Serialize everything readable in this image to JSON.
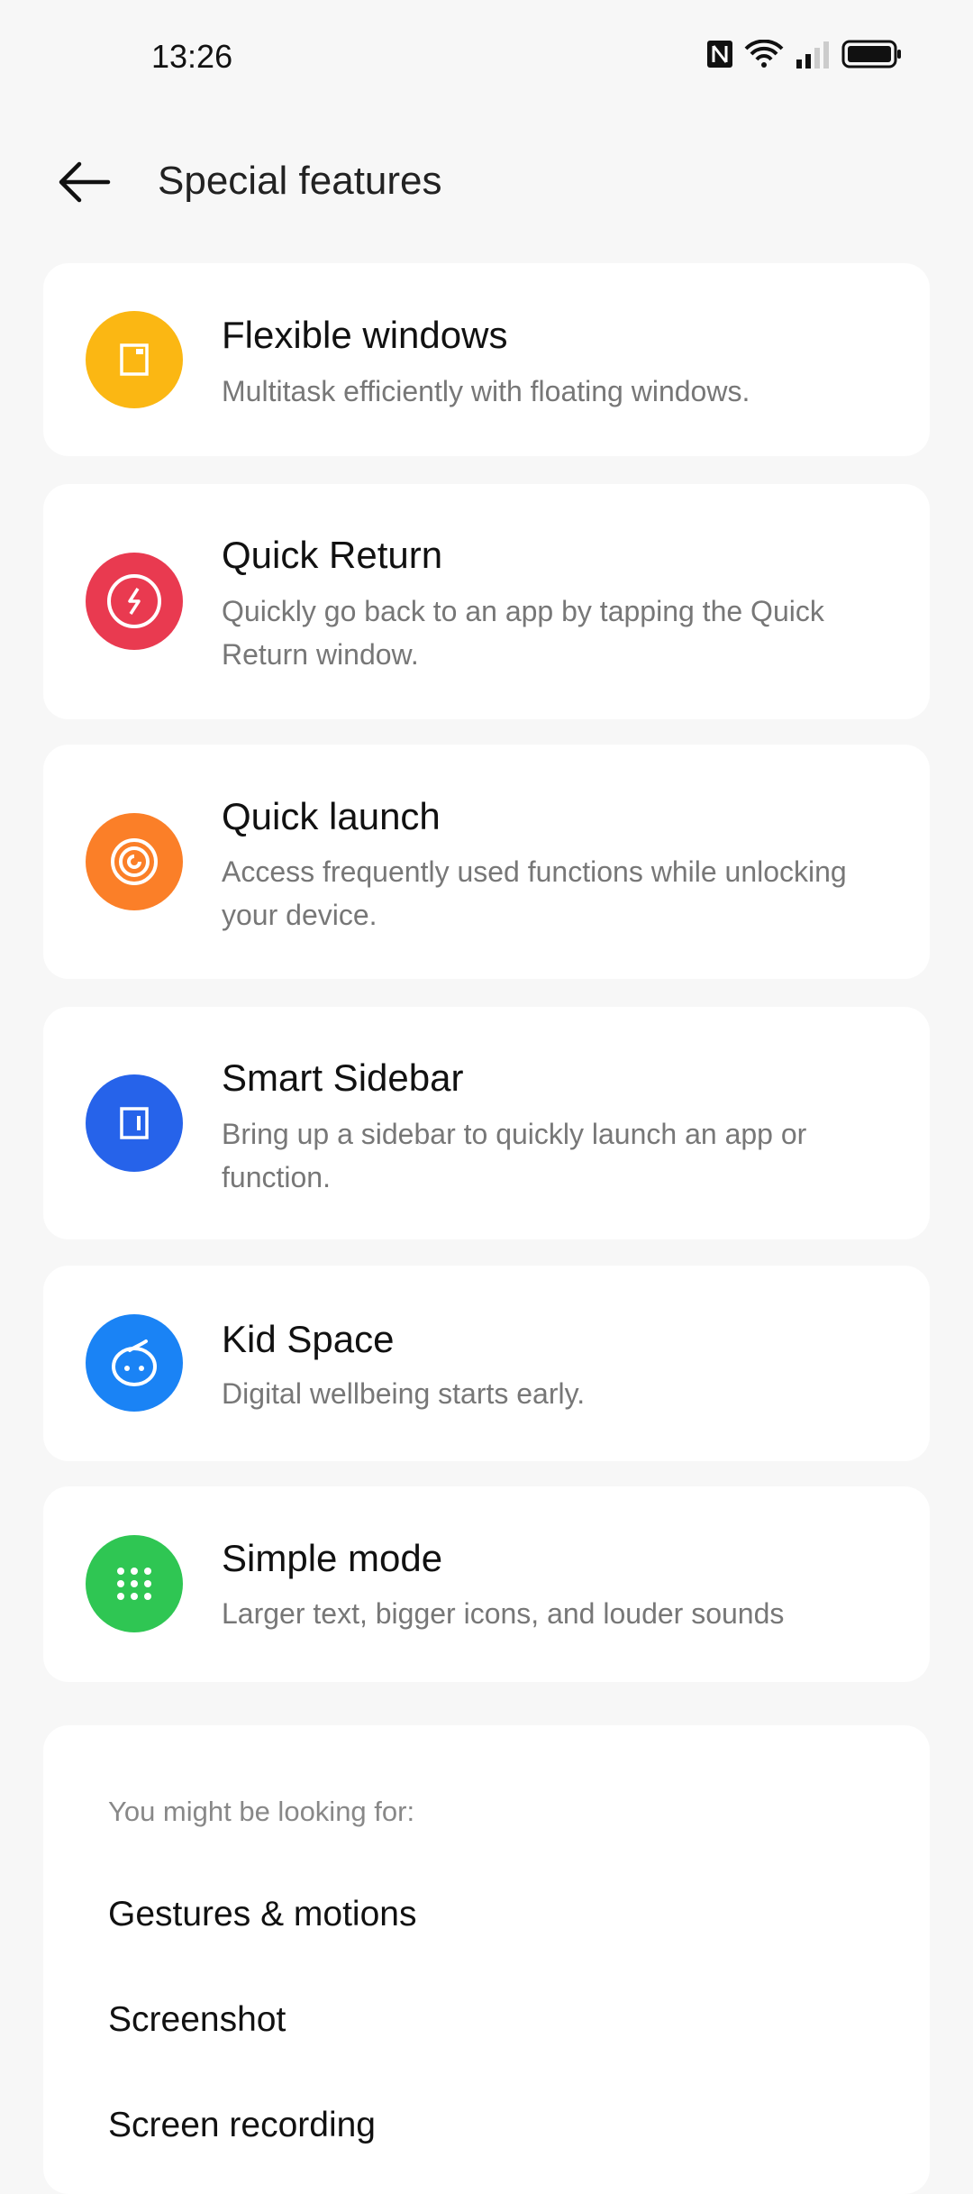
{
  "status_bar": {
    "time": "13:26",
    "icons": [
      "nfc-icon",
      "wifi-icon",
      "signal-icon",
      "battery-icon"
    ]
  },
  "header": {
    "title": "Special features",
    "back_icon": "arrow-left-icon"
  },
  "features": [
    {
      "title": "Flexible windows",
      "subtitle": "Multitask efficiently with floating windows.",
      "icon": "window-icon",
      "color": "#fbb713"
    },
    {
      "title": "Quick Return",
      "subtitle": "Quickly go back to an app by tapping the Quick Return window.",
      "icon": "lightning-circle-icon",
      "color": "#e93a50"
    },
    {
      "title": "Quick launch",
      "subtitle": "Access frequently used functions while unlocking your device.",
      "icon": "fingerprint-icon",
      "color": "#fb7f28"
    },
    {
      "title": "Smart Sidebar",
      "subtitle": "Bring up a sidebar to quickly launch an app or function.",
      "icon": "sidebar-icon",
      "color": "#2663ea"
    },
    {
      "title": "Kid Space",
      "subtitle": "Digital wellbeing starts early.",
      "icon": "kid-face-icon",
      "color": "#1a83f5"
    },
    {
      "title": "Simple mode",
      "subtitle": "Larger text, bigger icons, and louder sounds",
      "icon": "grid-dots-icon",
      "color": "#2fc653"
    }
  ],
  "suggestions": {
    "label": "You might be looking for:",
    "items": [
      "Gestures & motions",
      "Screenshot",
      "Screen recording"
    ]
  }
}
